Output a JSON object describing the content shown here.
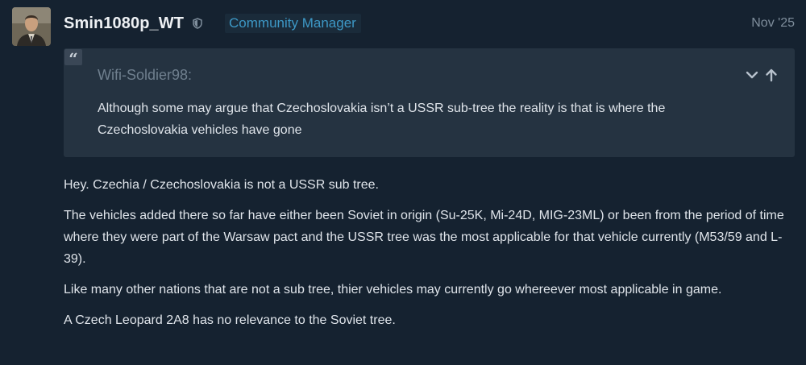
{
  "post": {
    "username": "Smin1080p_WT",
    "role": "Community Manager",
    "date": "Nov '25",
    "quote": {
      "author": "Wifi-Soldier98:",
      "text": "Although some may argue that Czechoslovakia isn’t a USSR sub-tree the reality is that is where the Czechoslovakia vehicles have gone"
    },
    "paragraphs": [
      "Hey. Czechia / Czechoslovakia is not a USSR sub tree.",
      "The vehicles added there so far have either been Soviet in origin (Su-25K, Mi-24D, MIG-23ML) or been from the period of time where they were part of the Warsaw pact and the USSR tree was the most applicable for that vehicle currently (M53/59 and L-39).",
      "Like many other nations that are not a sub tree, thier vehicles may currently go whereever most applicable in game.",
      "A Czech Leopard 2A8 has no relevance to the Soviet tree."
    ]
  },
  "icons": {
    "avatar": "user-avatar",
    "role_marker": "shield-icon",
    "quote": "quote-icon",
    "expand": "chevron-down-icon",
    "jump": "arrow-up-icon"
  },
  "colors": {
    "background": "#152230",
    "quote_background": "#253341",
    "role": "#3d98c6",
    "text": "#dfe4ea",
    "muted": "#7f8e9c"
  }
}
